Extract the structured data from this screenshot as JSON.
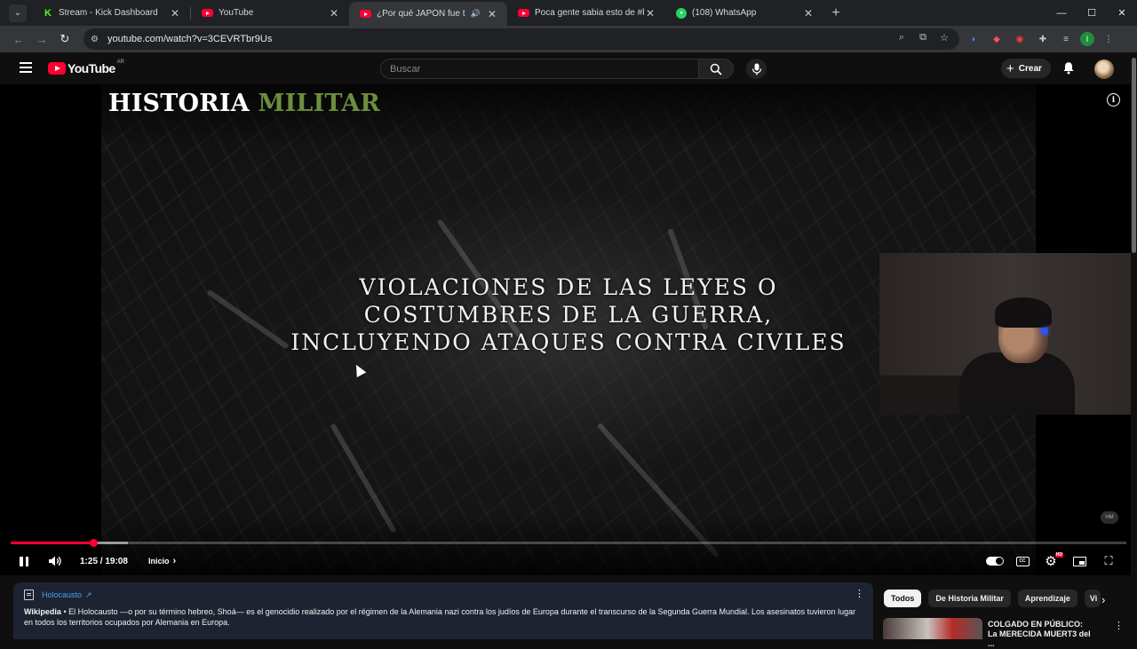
{
  "browser": {
    "tabs": [
      {
        "title": "Stream - Kick Dashboard",
        "favicon": "kick-icon",
        "active": false
      },
      {
        "title": "YouTube",
        "favicon": "youtube-icon",
        "active": false
      },
      {
        "title": "¿Por qué JAPÓN fue tan BR",
        "favicon": "youtube-icon",
        "active": true,
        "audio": true
      },
      {
        "title": "Poca gente sabia esto de #kaio",
        "favicon": "youtube-icon",
        "active": false
      },
      {
        "title": "(108) WhatsApp",
        "favicon": "whatsapp-icon",
        "active": false
      }
    ],
    "new_tab": "+",
    "url": "youtube.com/watch?v=3CEVRTbr9Us",
    "profile_initial": "I",
    "extension_badge": "1"
  },
  "youtube": {
    "logo_text": "YouTube",
    "region": "AR",
    "search_placeholder": "Buscar",
    "create_label": "Crear",
    "accent": "#ff0033"
  },
  "video": {
    "channel_title_white": "HISTORIA",
    "channel_title_green": "MILITAR",
    "overlay_lines": [
      "VIOLACIONES DE LAS LEYES O",
      "COSTUMBRES DE LA GUERRA,",
      "INCLUYENDO ATAQUES CONTRA CIVILES"
    ],
    "watermark": "HM",
    "time_display": "1:25 / 19:08",
    "chapter_label": "Inicio",
    "played_fraction": 0.074,
    "buffered_fraction": 0.105,
    "cc_label": "CC",
    "quality_badge": "HD"
  },
  "info_panel": {
    "topic": "Holocausto",
    "source": "Wikipedia",
    "text": " • El Holocausto —o por su término hebreo, Shoá— es el genocidio realizado por el régimen de la Alemania nazi contra los judíos de Europa durante el transcurso de la Segunda Guerra Mundial. Los asesinatos tuvieron lugar en todos los territorios ocupados por Alemania en Europa."
  },
  "sidebar": {
    "chips": [
      "Todos",
      "De Historia Militar",
      "Aprendizaje",
      "Vi"
    ],
    "recommendation_title": "COLGADO EN PÚBLICO: La MERECIDA MUERT3 del ..."
  }
}
